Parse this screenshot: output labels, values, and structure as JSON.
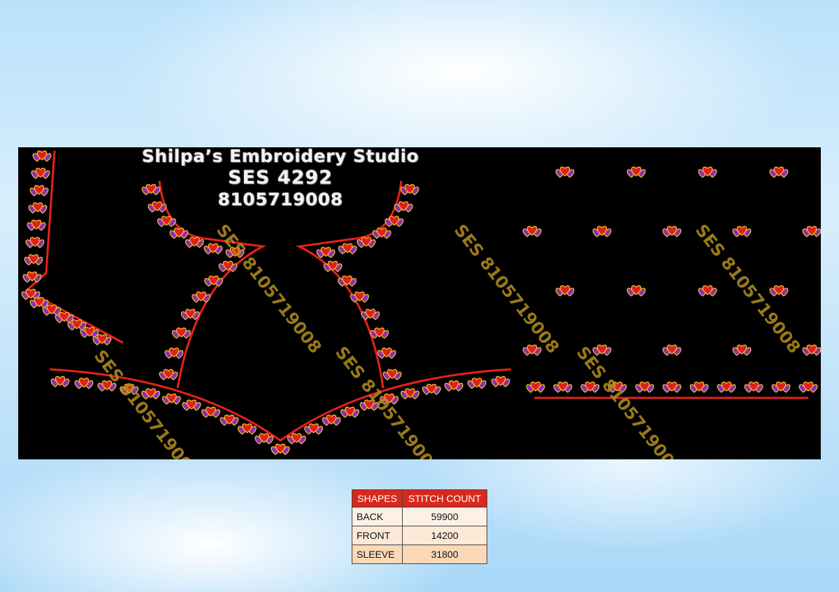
{
  "header": {
    "studio_name": "Shilpa’s Embroidery Studio",
    "design_code": "SES 4292",
    "phone": "8105719008"
  },
  "watermark_text": "SES 8105719008",
  "colors": {
    "background_design": "#000000",
    "outline_red": "#e8211a",
    "motif_purple": "#8b2fb4",
    "motif_red": "#e0201c",
    "motif_gold": "#f2c12e",
    "table_header": "#d9281c"
  },
  "stitch_table": {
    "headers": [
      "SHAPES",
      "STITCH COUNT"
    ],
    "rows": [
      {
        "shape": "BACK",
        "count": "59900"
      },
      {
        "shape": "FRONT",
        "count": "14200"
      },
      {
        "shape": "SLEEVE",
        "count": "31800"
      }
    ]
  }
}
